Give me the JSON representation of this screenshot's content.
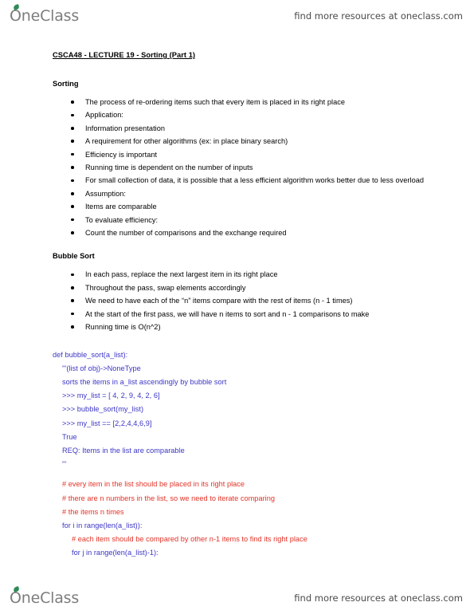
{
  "header": {
    "logo_text": "OneClass",
    "logo_icon": "leaf-icon",
    "promo_text": "find more resources at oneclass.com"
  },
  "footer": {
    "logo_text": "OneClass",
    "logo_icon": "leaf-icon",
    "promo_text": "find more resources at oneclass.com"
  },
  "document": {
    "title": "CSCA48 - LECTURE 19 - Sorting (Part 1)",
    "sections": [
      {
        "heading": "Sorting",
        "bullets": [
          "The process of re-ordering items such that every item is placed in its right place",
          "Application:",
          "Information presentation",
          "A requirement for other algorithms (ex: in place binary search)",
          "Efficiency is important",
          "Running time is dependent on the number of inputs",
          "For small collection of data, it is possible that a less efficient algorithm works better due to less overload",
          "Assumption:",
          "Items are comparable",
          "To evaluate efficiency:",
          "Count the number of comparisons and the exchange required"
        ]
      },
      {
        "heading": "Bubble Sort",
        "bullets": [
          "In each pass, replace the next largest item in its right place",
          "Throughout the pass, swap elements accordingly",
          "We need to have each of the “n” items compare with the rest of items (n - 1 times)",
          "At the start of the first pass, we will have n items to sort and n - 1 comparisons to make",
          "Running time is O(n^2)"
        ]
      }
    ],
    "code_lines": [
      {
        "text": "def bubble_sort(a_list):",
        "color": "#3b35c4",
        "indent": 0
      },
      {
        "text": "'''(list of obj)->NoneType",
        "color": "#3b35c4",
        "indent": 1
      },
      {
        "text": "sorts the items in a_list ascendingly by bubble sort",
        "color": "#3b35c4",
        "indent": 1
      },
      {
        "text": ">>> my_list = [ 4, 2, 9, 4, 2, 6]",
        "color": "#3b35c4",
        "indent": 1
      },
      {
        "text": ">>> bubble_sort(my_list)",
        "color": "#3b35c4",
        "indent": 1
      },
      {
        "text": ">>> my_list == [2,2,4,4,6,9]",
        "color": "#3b35c4",
        "indent": 1
      },
      {
        "text": "True",
        "color": "#3b35c4",
        "indent": 1
      },
      {
        "text": "REQ: Items in the list are comparable",
        "color": "#3b35c4",
        "indent": 1
      },
      {
        "text": "'''",
        "color": "#3b35c4",
        "indent": 1
      },
      {
        "text": "",
        "color": "#3b35c4",
        "indent": 1
      },
      {
        "text": "# every item in the list should be placed in its right place",
        "color": "#e23227",
        "indent": 1
      },
      {
        "text": "# there are n numbers in the list, so we need to iterate comparing",
        "color": "#e23227",
        "indent": 1
      },
      {
        "text": "# the items n times",
        "color": "#e23227",
        "indent": 1
      },
      {
        "text": "for i in range(len(a_list)):",
        "color": "#3b35c4",
        "indent": 1
      },
      {
        "text": "# each item should be compared by other n-1 items to find its right place",
        "color": "#e23227",
        "indent": 2
      },
      {
        "text": "for j in range(len(a_list)-1):",
        "color": "#3b35c4",
        "indent": 2
      }
    ]
  },
  "colors": {
    "code_blue": "#3b35c4",
    "comment_red": "#e23227",
    "brand_gray": "#7d7d7d",
    "leaf_green": "#2e8b57"
  }
}
